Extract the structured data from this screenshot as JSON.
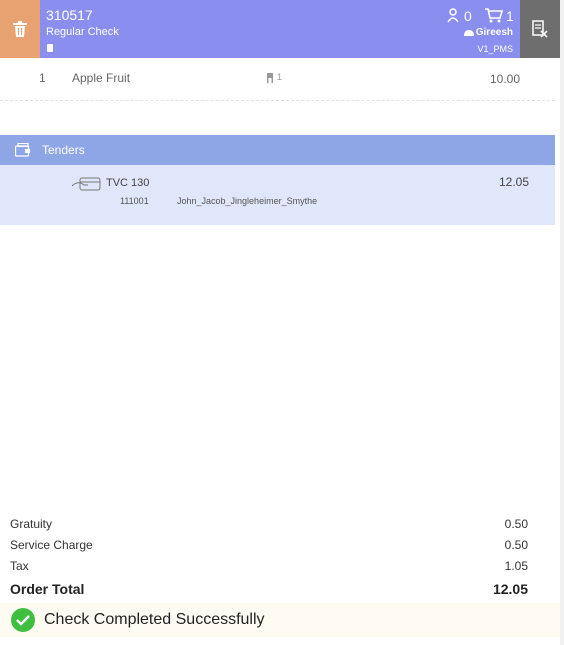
{
  "header": {
    "check_number": "310517",
    "check_type": "Regular Check",
    "guest_count": "0",
    "item_count": "1",
    "employee": "Gireesh",
    "revenue_center": "V1_PMS"
  },
  "items": [
    {
      "qty": "1",
      "name": "Apple Fruit",
      "seat": "1",
      "price": "10.00"
    }
  ],
  "tenders": {
    "title": "Tenders",
    "entries": [
      {
        "name": "TVC 130",
        "amount": "12.05",
        "number": "111001",
        "holder": "John_Jacob_Jingleheimer_Smythe"
      }
    ]
  },
  "summary": {
    "gratuity_label": "Gratuity",
    "gratuity": "0.50",
    "service_label": "Service Charge",
    "service": "0.50",
    "tax_label": "Tax",
    "tax": "1.05",
    "total_label": "Order Total",
    "total": "12.05"
  },
  "status": {
    "message": "Check Completed Successfully"
  },
  "colors": {
    "header": "#8a8eef",
    "trash": "#e8a271",
    "close": "#6e6e6e",
    "tenders": "#8fa6e6",
    "success": "#3fbf3f"
  },
  "icons": [
    "trash-icon",
    "guest-icon",
    "cart-icon",
    "employee-icon",
    "close-check-icon",
    "seat-icon",
    "tenders-icon",
    "tender-card-icon",
    "check-circle-icon"
  ]
}
